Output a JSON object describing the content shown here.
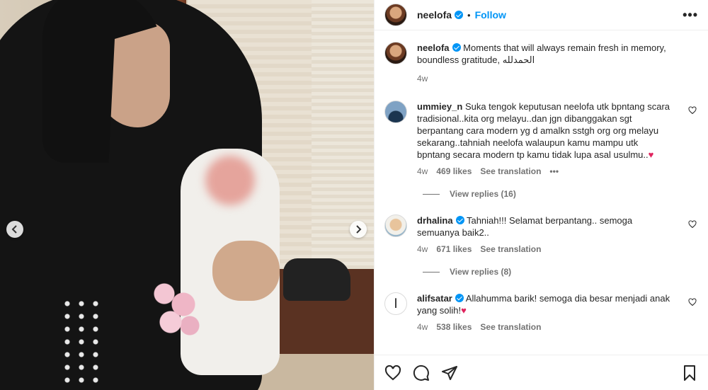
{
  "post": {
    "username": "neelofa",
    "follow_label": "Follow",
    "dot": "•",
    "more_label": "•••"
  },
  "caption": {
    "username": "neelofa",
    "text": "Moments that will always remain fresh in memory, boundless gratitude, الحمدلله",
    "time": "4w"
  },
  "comments": [
    {
      "username": "ummiey_n",
      "verified": false,
      "text": "Suka tengok keputusan neelofa utk bpntang scara tradisional..kita org melayu..dan jgn dibanggakan sgt berpantang cara modern yg d amalkn sstgh org org melayu sekarang..tahniah neelofa walaupun kamu mampu utk bpntang secara modern tp kamu tidak lupa asal usulmu..",
      "emoji": "♥",
      "time": "4w",
      "likes": "469 likes",
      "see_translation": "See translation",
      "more": "•••",
      "view_replies": "View replies (16)"
    },
    {
      "username": "drhalina",
      "verified": true,
      "text": "Tahniah!!! Selamat berpantang.. semoga semuanya baik2..",
      "emoji": "",
      "time": "4w",
      "likes": "671 likes",
      "see_translation": "See translation",
      "view_replies": "View replies (8)"
    },
    {
      "username": "alifsatar",
      "verified": true,
      "avatar_glyph": "ا",
      "text": "Allahumma barik! semoga dia besar menjadi anak yang solih!",
      "emoji": "♥",
      "time": "4w",
      "likes": "538 likes",
      "see_translation": "See translation"
    }
  ],
  "colors": {
    "accent": "#0095f6",
    "text": "#262626",
    "muted": "#737373",
    "heart": "#e0245e"
  },
  "icons": [
    "chevron-left-icon",
    "chevron-right-icon",
    "heart-icon",
    "comment-icon",
    "share-icon",
    "bookmark-icon",
    "more-icon",
    "verified-icon"
  ]
}
